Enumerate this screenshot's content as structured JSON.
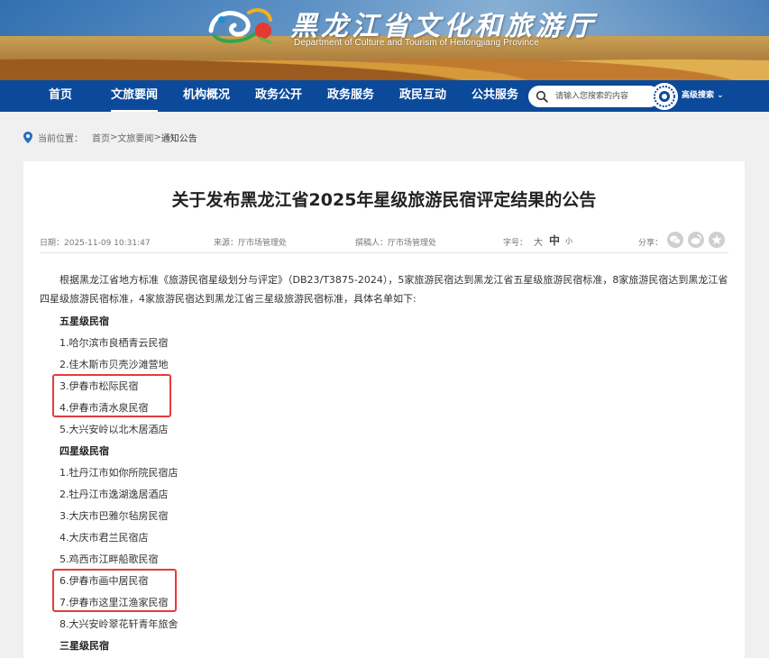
{
  "header": {
    "site_title_cn": "黑龙江省文化和旅游厅",
    "site_title_en": "Department of Culture and Tourism of Heilongjiang Province",
    "logo_icon": "province-logo-icon"
  },
  "nav": {
    "items": [
      {
        "label": "首页"
      },
      {
        "label": "文旅要闻",
        "active": true
      },
      {
        "label": "机构概况"
      },
      {
        "label": "政务公开"
      },
      {
        "label": "政务服务"
      },
      {
        "label": "政民互动"
      },
      {
        "label": "公共服务"
      }
    ],
    "search_placeholder": "请输入您搜索的内容",
    "advanced_search": "高级搜索 ⌄"
  },
  "breadcrumb": {
    "prefix": "当前位置：",
    "home": "首页",
    "sep": ">",
    "section": "文旅要闻",
    "current": "通知公告"
  },
  "article": {
    "title": "关于发布黑龙江省2025年星级旅游民宿评定结果的公告",
    "date": "日期：2025-11-09 10:31:47",
    "source": "来源：厅市场管理处",
    "author": "撰稿人：厅市场管理处",
    "font_size_label": "字号：",
    "font_size_large": "大",
    "font_size_mid": "中",
    "font_size_small": "小",
    "share_label": "分享：",
    "intro": "根据黑龙江省地方标准《旅游民宿星级划分与评定》（DB23/T3875-2024），5家旅游民宿达到黑龙江省五星级旅游民宿标准，8家旅游民宿达到黑龙江省四星级旅游民宿标准，4家旅游民宿达到黑龙江省三星级旅游民宿标准，具体名单如下:",
    "list": [
      {
        "text": "五星级民宿",
        "head": true
      },
      {
        "text": "1.哈尔滨市良栖青云民宿"
      },
      {
        "text": "2.佳木斯市贝壳沙滩营地"
      },
      {
        "text": "3.伊春市松际民宿"
      },
      {
        "text": "4.伊春市清水泉民宿"
      },
      {
        "text": "5.大兴安岭以北木居酒店"
      },
      {
        "text": "四星级民宿",
        "head": true
      },
      {
        "text": "1.牡丹江市如你所院民宿店"
      },
      {
        "text": "2.牡丹江市逸湖逸居酒店"
      },
      {
        "text": "3.大庆市巴雅尔毡房民宿"
      },
      {
        "text": "4.大庆市君兰民宿店"
      },
      {
        "text": "5.鸡西市江畔船歌民宿"
      },
      {
        "text": "6.伊春市画中居民宿"
      },
      {
        "text": "7.伊春市这里江渔家民宿"
      },
      {
        "text": "8.大兴安岭翠花轩青年旅舍"
      },
      {
        "text": "三星级民宿",
        "head": true
      }
    ]
  },
  "colors": {
    "nav_bg": "#0b4a9b",
    "highlight": "#e53b3b"
  }
}
